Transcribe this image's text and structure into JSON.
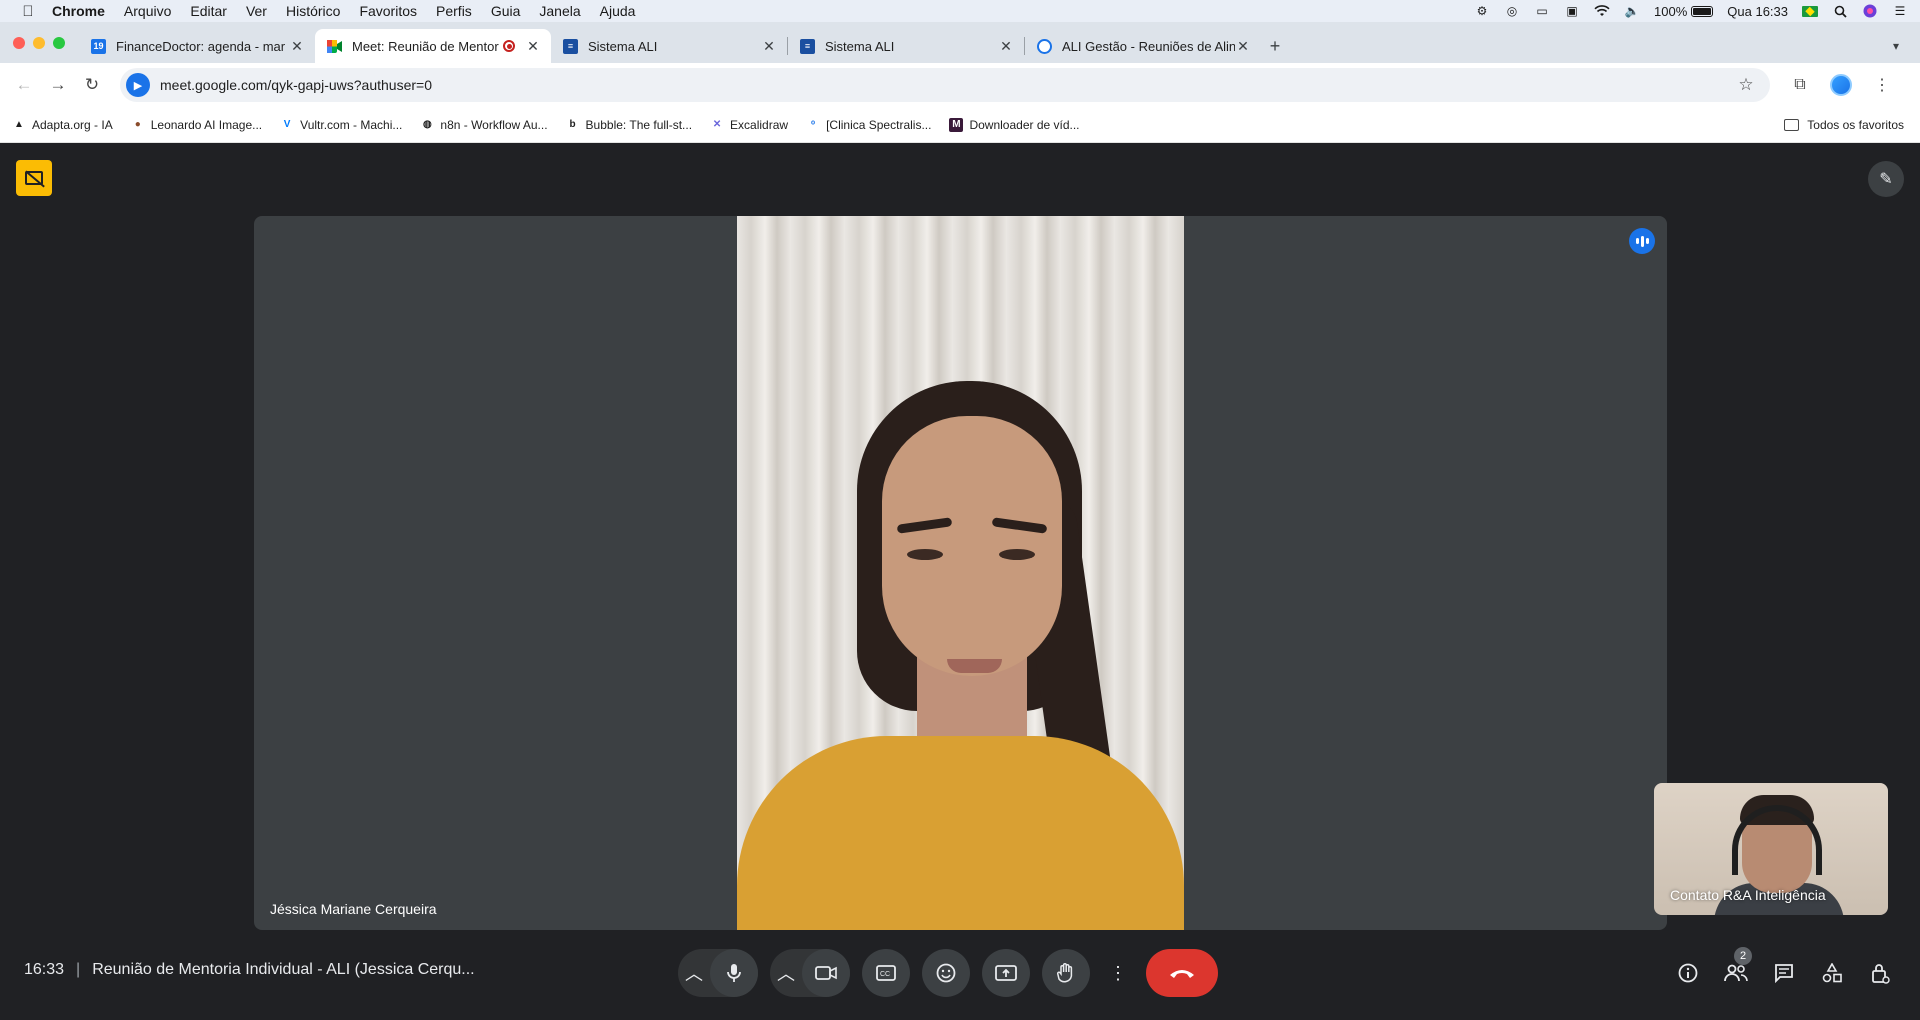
{
  "menubar": {
    "items": [
      "Chrome",
      "Arquivo",
      "Editar",
      "Ver",
      "Histórico",
      "Favoritos",
      "Perfis",
      "Guia",
      "Janela",
      "Ajuda"
    ],
    "battery": "100%",
    "clock": "Qua 16:33"
  },
  "tabs": [
    {
      "title": "FinanceDoctor: agenda - mar",
      "favicon": "calendar-icon",
      "color": "#1a73e8"
    },
    {
      "title": "Meet: Reunião de Mentori",
      "favicon": "meet-icon",
      "color": "#00897b",
      "active": true
    },
    {
      "title": "Sistema ALI",
      "favicon": "ali-icon",
      "color": "#1a4fa0"
    },
    {
      "title": "Sistema ALI",
      "favicon": "ali-icon",
      "color": "#1a4fa0"
    },
    {
      "title": "ALI Gestão - Reuniões de Alin",
      "favicon": "ali-gestao-icon",
      "color": "#1a73e8"
    }
  ],
  "toolbar": {
    "url": "meet.google.com/qyk-gapj-uws?authuser=0"
  },
  "bookmarks": {
    "items": [
      {
        "label": "Adapta.org - IA",
        "icon": "A"
      },
      {
        "label": "Leonardo AI Image...",
        "icon": "L"
      },
      {
        "label": "Vultr.com - Machi...",
        "icon": "V"
      },
      {
        "label": "n8n - Workflow Au...",
        "icon": "n"
      },
      {
        "label": "Bubble: The full-st...",
        "icon": "b"
      },
      {
        "label": "Excalidraw",
        "icon": "✕"
      },
      {
        "label": "[Clinica Spectralis...",
        "icon": "o"
      },
      {
        "label": "Downloader de víd...",
        "icon": "M"
      }
    ],
    "all_label": "Todos os favoritos"
  },
  "meet": {
    "main_participant": "Jéssica Mariane Cerqueira",
    "self_participant": "Contato R&A Inteligência",
    "time": "16:33",
    "meeting_title": "Reunião de Mentoria Individual - ALI (Jessica Cerqu...",
    "participants_count": "2",
    "colors": {
      "end_call": "#dc362e",
      "badge": "#fbbc04",
      "speaking": "#1a73e8"
    }
  }
}
